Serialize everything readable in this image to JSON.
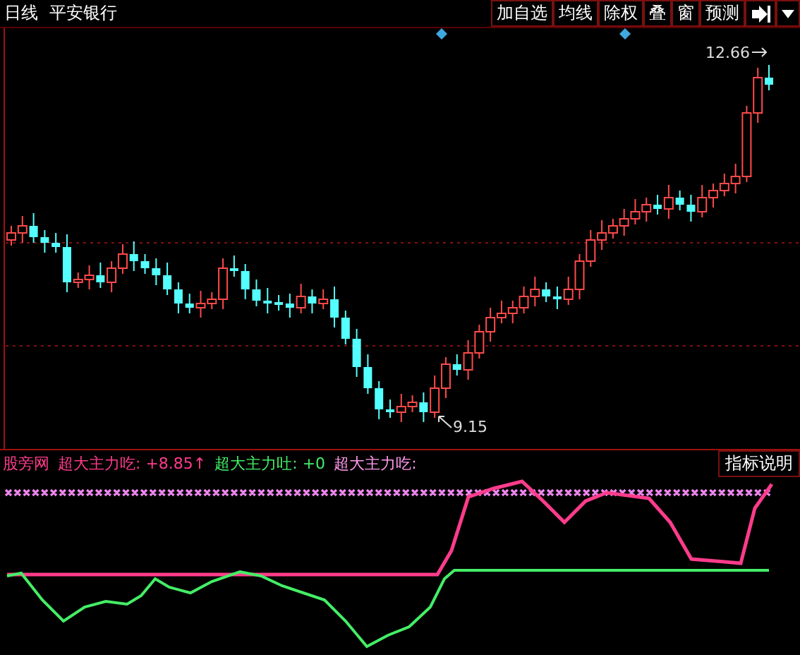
{
  "toolbar": {
    "period": "日线",
    "stock_name": "平安银行",
    "buttons": [
      {
        "label": "加自选"
      },
      {
        "label": "均线"
      },
      {
        "label": "除权"
      },
      {
        "label": "叠"
      },
      {
        "label": "窗"
      },
      {
        "label": "预测"
      }
    ]
  },
  "main_chart": {
    "high_label": "12.66",
    "low_label": "9.15"
  },
  "indicator": {
    "name": "股旁网",
    "readings": [
      {
        "text": "超大主力吃: +8.85↑",
        "color": "#ff3c8c"
      },
      {
        "text": "超大主力吐: +0",
        "color": "#44ee66"
      },
      {
        "text": "超大主力吃:",
        "color": "#ff99ee"
      }
    ],
    "help_button": "指标说明"
  }
}
